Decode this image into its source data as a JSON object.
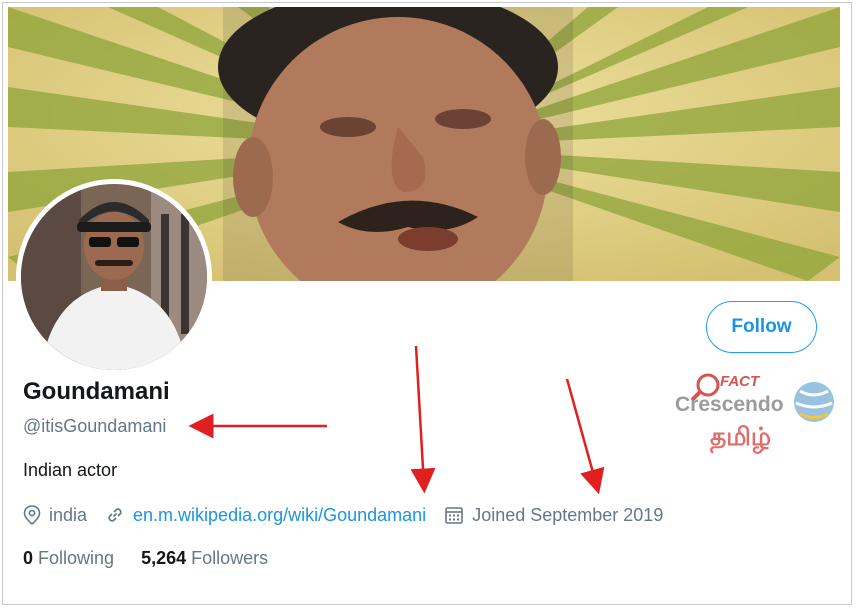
{
  "profile": {
    "name": "Goundamani",
    "handle": "@itisGoundamani",
    "bio": "Indian actor",
    "location": "india",
    "website": "en.m.wikipedia.org/wiki/Goundamani",
    "joined": "Joined September 2019",
    "following_count": "0",
    "following_label": "Following",
    "followers_count": "5,264",
    "followers_label": "Followers"
  },
  "actions": {
    "follow_label": "Follow"
  },
  "watermark": {
    "line1": "FACT",
    "line2": "Crescendo",
    "line3": "தமிழ்"
  },
  "icons": {
    "location": "location-pin-icon",
    "link": "link-icon",
    "calendar": "calendar-icon"
  },
  "colors": {
    "accent": "#1da1f2",
    "link": "#1b95e0",
    "annotation": "#e02020"
  }
}
